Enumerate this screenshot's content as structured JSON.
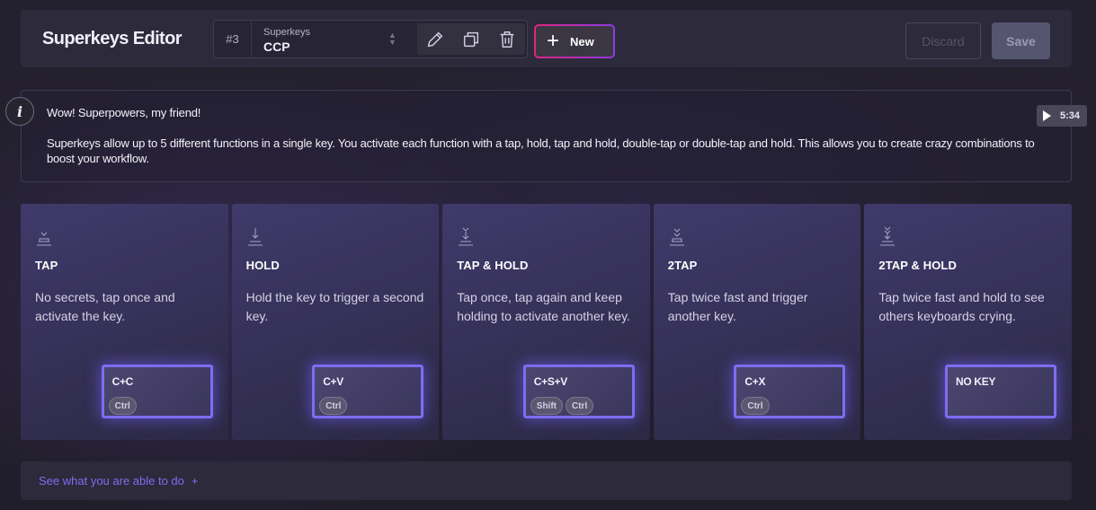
{
  "header": {
    "title": "Superkeys Editor",
    "selector": {
      "number": "#3",
      "label": "Superkeys",
      "value": "CCP"
    },
    "new_label": "New",
    "discard_label": "Discard",
    "save_label": "Save"
  },
  "info": {
    "icon_letter": "i",
    "title": "Wow! Superpowers, my friend!",
    "body": "Superkeys allow up to 5 different functions in a single key. You activate each function with a tap, hold, tap and hold, double-tap or double-tap and hold. This allows you to create crazy combinations to boost your workflow.",
    "video_duration": "5:34"
  },
  "cards": [
    {
      "title": "TAP",
      "description": "No secrets, tap once and activate the key.",
      "icon": "tap-icon",
      "key_label": "C+C",
      "mods": [
        "Ctrl"
      ]
    },
    {
      "title": "HOLD",
      "description": "Hold the key to trigger a second key.",
      "icon": "hold-icon",
      "key_label": "C+V",
      "mods": [
        "Ctrl"
      ]
    },
    {
      "title": "TAP & HOLD",
      "description": "Tap once, tap again and keep holding to activate another key.",
      "icon": "tap-hold-icon",
      "key_label": "C+S+V",
      "mods": [
        "Shift",
        "Ctrl"
      ]
    },
    {
      "title": "2TAP",
      "description": "Tap twice fast and trigger another key.",
      "icon": "double-tap-icon",
      "key_label": "C+X",
      "mods": [
        "Ctrl"
      ]
    },
    {
      "title": "2TAP & HOLD",
      "description": "Tap twice fast and hold to see others keyboards crying.",
      "icon": "double-tap-hold-icon",
      "key_label": "NO KEY",
      "mods": []
    }
  ],
  "footer": {
    "link_label": "See what you are able to do",
    "link_plus": "+"
  },
  "colors": {
    "accent": "#7e6df1",
    "new_gradient_start": "#e0257f",
    "new_gradient_end": "#8d3ae6",
    "link": "#7f6ef0"
  }
}
